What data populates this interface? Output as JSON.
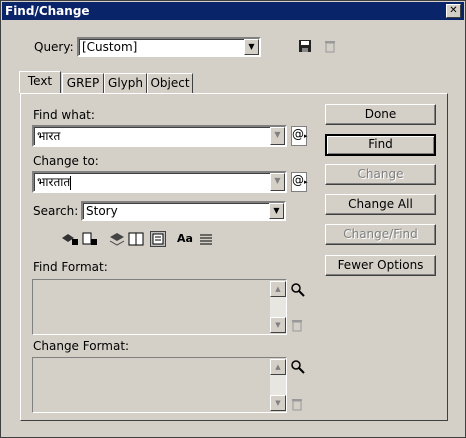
{
  "window": {
    "title": "Find/Change"
  },
  "query": {
    "label": "Query:",
    "value": "[Custom]"
  },
  "tabs": [
    {
      "label": "Text"
    },
    {
      "label": "GREP"
    },
    {
      "label": "Glyph"
    },
    {
      "label": "Object"
    }
  ],
  "find_what": {
    "label": "Find what:",
    "value": "भारत"
  },
  "change_to": {
    "label": "Change to:",
    "value": "भारतात"
  },
  "search": {
    "label": "Search:",
    "value": "Story"
  },
  "find_format": {
    "label": "Find Format:"
  },
  "change_format": {
    "label": "Change Format:"
  },
  "buttons": {
    "done": "Done",
    "find": "Find",
    "change": "Change",
    "change_all": "Change All",
    "change_find": "Change/Find",
    "fewer_options": "Fewer Options"
  },
  "option_icons": {
    "case_label": "Aa"
  },
  "colors": {
    "titlebar": "#0a246a",
    "face": "#d4d0c8"
  }
}
